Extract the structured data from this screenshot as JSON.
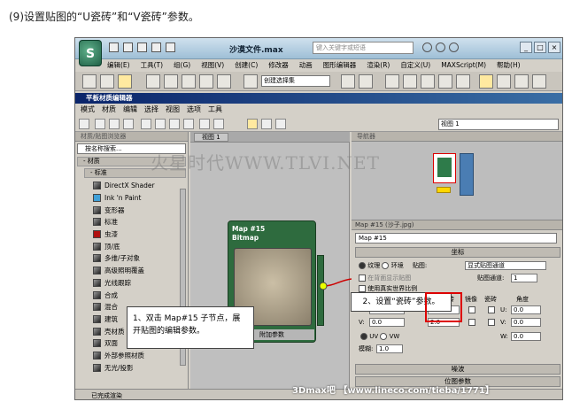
{
  "caption": "(9)设置贴图的“U瓷砖”和“V瓷砖”参数。",
  "app": {
    "file_title": "沙漠文件.max",
    "search_placeholder": "键入关键字或短语",
    "menu": [
      "编辑(E)",
      "工具(T)",
      "组(G)",
      "视图(V)",
      "创建(C)",
      "修改器",
      "动画",
      "图形编辑器",
      "渲染(R)",
      "自定义(U)",
      "MAXScript(M)",
      "帮助(H)"
    ],
    "selection_set": "创建选择集"
  },
  "editor": {
    "title": "平板材质编辑器",
    "menu": [
      "模式",
      "材质",
      "编辑",
      "选择",
      "视图",
      "选项",
      "工具"
    ],
    "view_select": "视图 1"
  },
  "browser": {
    "header": "材质/贴图浏览器",
    "search": "按名称搜索...",
    "group": "- 材质",
    "subgroup": "- 标准",
    "items": [
      "DirectX Shader",
      "Ink 'n Paint",
      "变形器",
      "标准",
      "虫漆",
      "顶/底",
      "多维/子对象",
      "高级照明覆盖",
      "光线跟踪",
      "合成",
      "混合",
      "建筑",
      "壳材质",
      "双面",
      "外部参照材质",
      "无光/投影"
    ]
  },
  "view": {
    "tab": "视图 1",
    "node_title1": "Map #15",
    "node_title2": "Bitmap",
    "node_footer": "附加参数"
  },
  "callout1": "1、双击 Map#15 子节点，展开贴图的编辑参数。",
  "navigator": {
    "header": "导航器"
  },
  "props": {
    "title": "Map #15 (沙子.jpg)",
    "map_name": "Map #15",
    "rollout": "坐标",
    "texture": "纹理",
    "environ": "环境",
    "mapping_label": "贴图:",
    "mapping_value": "显式贴图通道",
    "show_in_viewport": "在背面显示贴图",
    "channel_label": "贴图通道:",
    "channel_value": "1",
    "real_world": "使用真实世界比例",
    "col_offset": "偏移",
    "col_tiling": "瓷砖",
    "col_mirror": "镜像",
    "col_tile": "瓷砖",
    "col_angle": "角度",
    "u": "U:",
    "v": "V:",
    "w": "W:",
    "u_offset": "0.0",
    "v_offset": "0.0",
    "u_tiling": "2.0",
    "v_tiling": "2.0",
    "u_angle": "0.0",
    "v_angle": "0.0",
    "w_angle": "0.0",
    "uv": "UV",
    "vw": "VW",
    "wu": "WU",
    "blur_label": "模糊:",
    "blur_value": "1.0",
    "blur_offset_label": "模糊偏移:",
    "blur_offset_value": "0.0",
    "rollout_noise": "噪波",
    "rollout_bitmap": "位图参数"
  },
  "callout2": "2、设置“瓷砖”参数。",
  "status": "已完成渲染",
  "watermark": "火星时代WWW.TLVI.NET",
  "footer": "3Dmax吧 【www.lineco.com/tieba/1771】"
}
